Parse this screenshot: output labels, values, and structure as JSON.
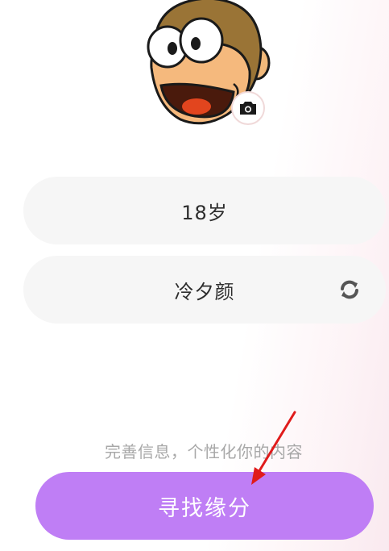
{
  "profile": {
    "avatar_icon": "cartoon-monkey-avatar",
    "camera_icon": "camera-icon"
  },
  "form": {
    "age_value": "18岁",
    "nickname_value": "冷夕颜",
    "refresh_icon": "refresh-icon"
  },
  "hint_text": "完善信息，个性化你的内容",
  "submit_label": "寻找缘分",
  "colors": {
    "accent": "#bf7ef5",
    "field_bg": "#f6f6f6",
    "hint_text": "#a8a8a8",
    "annotation_arrow": "#e01b1b"
  }
}
